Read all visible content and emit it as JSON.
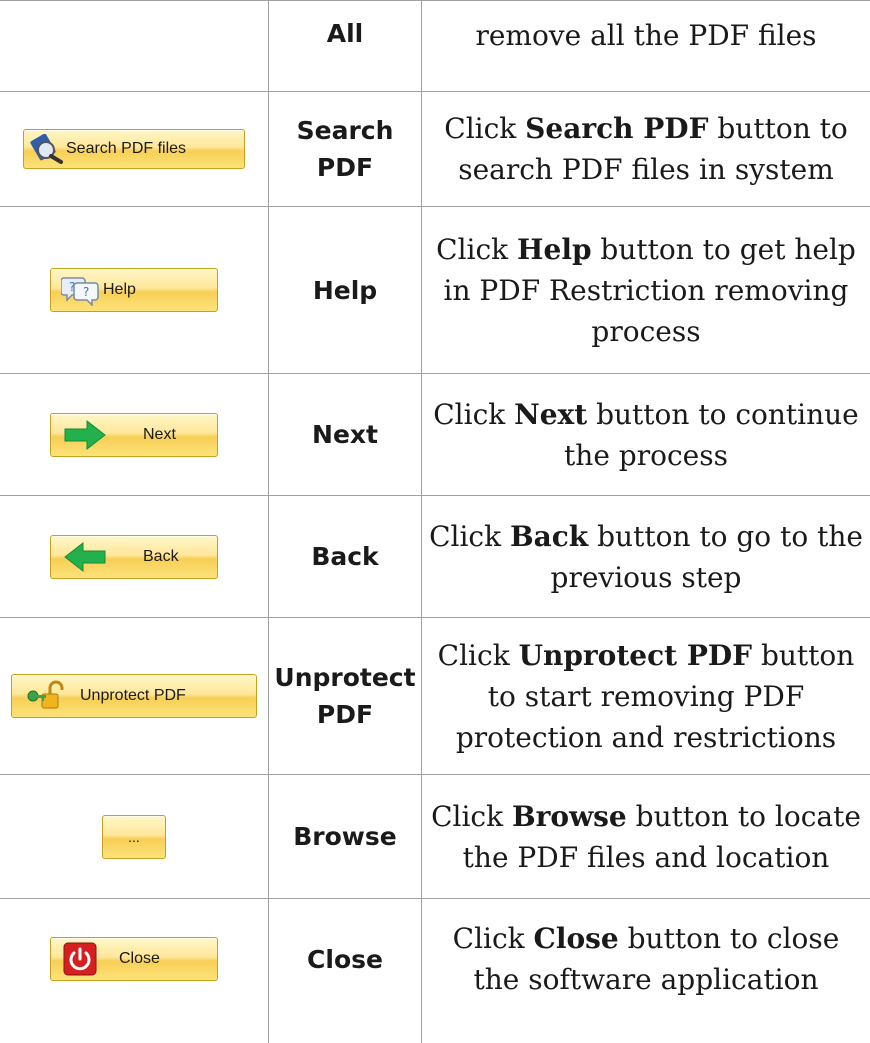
{
  "rows": [
    {
      "name": "All",
      "button_label": "",
      "icon": "none",
      "desc_pre": "remove all the PDF files",
      "desc_bold": "",
      "desc_post": ""
    },
    {
      "name": "Search PDF",
      "button_label": "Search PDF files",
      "icon": "magnifier-file-icon",
      "desc_pre": "Click ",
      "desc_bold": "Search PDF",
      "desc_post": " button to search PDF files in system"
    },
    {
      "name": "Help",
      "button_label": "Help",
      "icon": "help-bubbles-icon",
      "desc_pre": "Click ",
      "desc_bold": "Help",
      "desc_post": " button to get help in PDF Restriction removing process"
    },
    {
      "name": "Next",
      "button_label": "Next",
      "icon": "arrow-right-icon",
      "desc_pre": "Click ",
      "desc_bold": "Next",
      "desc_post": " button to continue the process"
    },
    {
      "name": "Back",
      "button_label": "Back",
      "icon": "arrow-left-icon",
      "desc_pre": "Click ",
      "desc_bold": "Back",
      "desc_post": " button to go to the previous step"
    },
    {
      "name": "Unprotect PDF",
      "button_label": "Unprotect PDF",
      "icon": "unlock-icon",
      "desc_pre": "Click ",
      "desc_bold": "Unprotect PDF",
      "desc_post": " button to start removing PDF protection and restrictions"
    },
    {
      "name": "Browse",
      "button_label": "...",
      "icon": "none",
      "desc_pre": "Click ",
      "desc_bold": "Browse",
      "desc_post": " button to locate the PDF files and location"
    },
    {
      "name": "Close",
      "button_label": "Close",
      "icon": "power-icon",
      "desc_pre": "Click ",
      "desc_bold": "Close",
      "desc_post": " button to close the software application"
    }
  ],
  "colors": {
    "button_fill": "#ffe79a",
    "button_border": "#c8a020",
    "arrow_green": "#22b14c",
    "power_red": "#d42020",
    "grid": "#a0a0a0"
  }
}
